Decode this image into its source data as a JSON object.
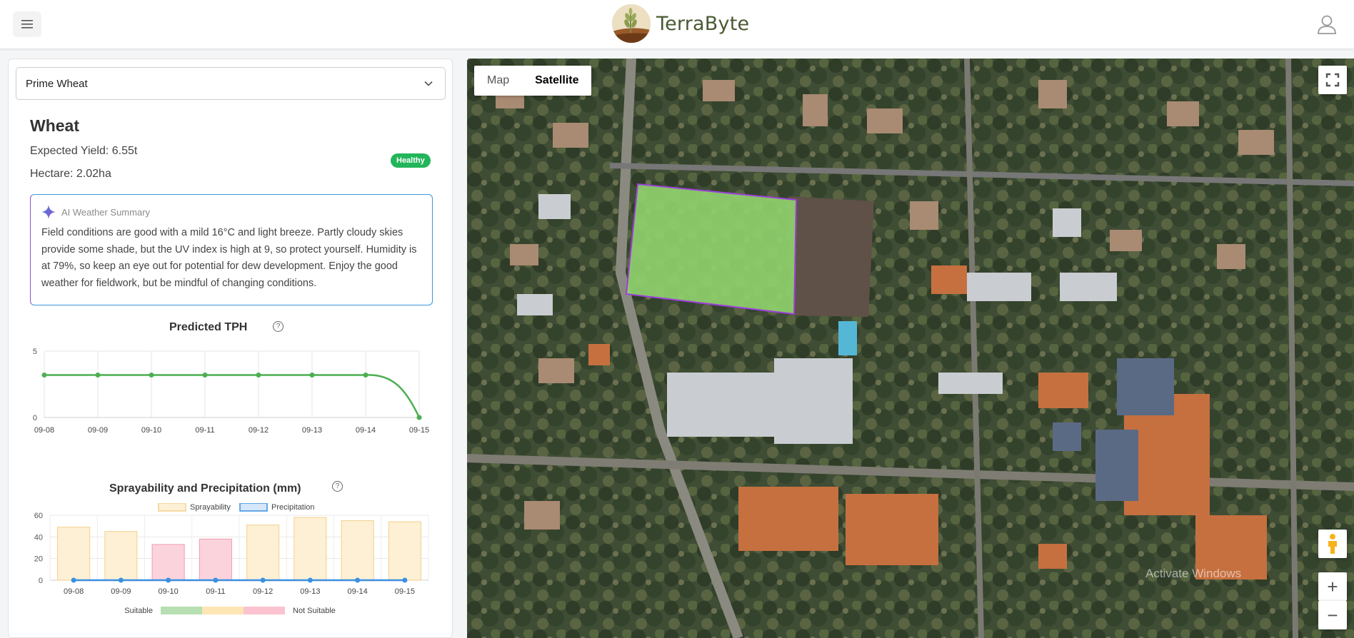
{
  "app": {
    "brand": "TerraByte"
  },
  "header": {
    "menu_icon": "hamburger-menu-icon",
    "user_icon": "user-profile-icon"
  },
  "field_select": {
    "selected": "Prime Wheat"
  },
  "crop": {
    "name": "Wheat",
    "expected_yield": "Expected Yield: 6.55t",
    "hectare": "Hectare: 2.02ha",
    "status": "Healthy",
    "status_color": "#22b55a"
  },
  "ai_summary": {
    "title": "AI Weather Summary",
    "text": "Field conditions are good with a mild 16°C and light breeze. Partly cloudy skies provide some shade, but the UV index is high at 9, so protect yourself. Humidity is at 79%, so keep an eye out for potential for dew development. Enjoy the good weather for fieldwork, but be mindful of changing conditions."
  },
  "tph_chart": {
    "help": "?",
    "chart_data": {
      "type": "line",
      "title": "Predicted TPH",
      "categories": [
        "09-08",
        "09-09",
        "09-10",
        "09-11",
        "09-12",
        "09-13",
        "09-14",
        "09-15"
      ],
      "values": [
        3.2,
        3.2,
        3.2,
        3.2,
        3.2,
        3.2,
        3.2,
        0
      ],
      "ylim": [
        0,
        5
      ],
      "yticks": [
        "0",
        "5"
      ],
      "grid": true,
      "color": "#4caf50"
    }
  },
  "spray_chart": {
    "help": "?",
    "chart_data": {
      "type": "bar",
      "title": "Sprayability and Precipitation (mm)",
      "categories": [
        "09-08",
        "09-09",
        "09-10",
        "09-11",
        "09-12",
        "09-13",
        "09-14",
        "09-15"
      ],
      "series": [
        {
          "name": "Sprayability",
          "values": [
            49,
            45,
            33,
            38,
            51,
            58,
            55,
            54
          ]
        },
        {
          "name": "Precipitation",
          "values": [
            0,
            0,
            0,
            0,
            0,
            0,
            0,
            0
          ]
        }
      ],
      "bar_colors": [
        "#fdf0d4",
        "#fdf0d4",
        "#fbd3dc",
        "#fbd3dc",
        "#fdf0d4",
        "#fdf0d4",
        "#fdf0d4",
        "#fdf0d4"
      ],
      "ylim": [
        0,
        60
      ],
      "yticks": [
        "0",
        "20",
        "40",
        "60"
      ],
      "legend": "top",
      "scale_labels": {
        "left": "Suitable",
        "right": "Not Suitable"
      },
      "scale_colors": [
        "#b7dfb2",
        "#fde6b3",
        "#fbc3cf"
      ]
    }
  },
  "map": {
    "tabs": [
      "Map",
      "Satellite"
    ],
    "active_tab": "Satellite",
    "fullscreen_icon": "fullscreen-icon",
    "pegman_icon": "street-view-pegman-icon",
    "zoom_in": "+",
    "zoom_out": "−",
    "watermark": "Activate Windows"
  }
}
